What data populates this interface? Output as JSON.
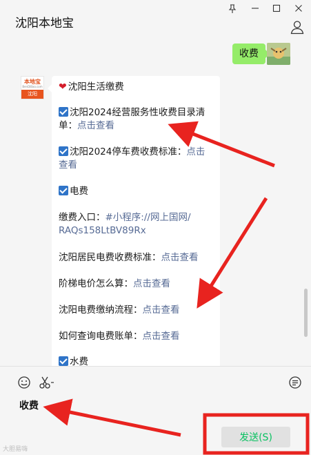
{
  "window": {
    "title": "沈阳本地宝",
    "controls": [
      "pin-icon",
      "minimize-icon",
      "maximize-icon",
      "close-icon"
    ]
  },
  "chat": {
    "outgoing": {
      "text": "收费"
    },
    "bot_avatar": {
      "brand": "本地宝",
      "sub": "BenDiBao.com",
      "city": "沈阳"
    },
    "incoming": {
      "lines": [
        {
          "id": "title",
          "text": "沈阳生活缴费"
        },
        {
          "id": "item1_a",
          "text": "沈阳2024经营服务性收费目录清"
        },
        {
          "id": "item1_b",
          "prefix": "单：",
          "link": "点击查看"
        },
        {
          "id": "item2_a",
          "text": "沈阳2024停车费收费标准：",
          "link": "点击"
        },
        {
          "id": "item2_b",
          "link": "查看"
        },
        {
          "id": "elec",
          "text": "电费"
        },
        {
          "id": "pay_a",
          "prefix": "缴费入口：",
          "link": "#小程序://网上国网/"
        },
        {
          "id": "pay_b",
          "link": "RAQs158LtBV89Rx"
        },
        {
          "id": "std",
          "text": "沈阳居民电费收费标准：",
          "link": "点击查看"
        },
        {
          "id": "tier",
          "text": "阶梯电价怎么算：",
          "link": "点击查看"
        },
        {
          "id": "flow",
          "text": "沈阳电费缴纳流程：",
          "link": "点击查看"
        },
        {
          "id": "bill",
          "text": "如何查询电费账单：",
          "link": "点击查看"
        },
        {
          "id": "water",
          "text": "水费"
        }
      ]
    }
  },
  "input": {
    "text": "收费",
    "send_label": "发送(S)",
    "watermark": "大胆易嗨",
    "tools": [
      "emoji-icon",
      "scissors-icon",
      "chat-history-icon"
    ]
  },
  "colors": {
    "accent_green": "#95ec69",
    "link": "#576b95",
    "send_text": "#07c160",
    "annotation_red": "#e8231f"
  }
}
